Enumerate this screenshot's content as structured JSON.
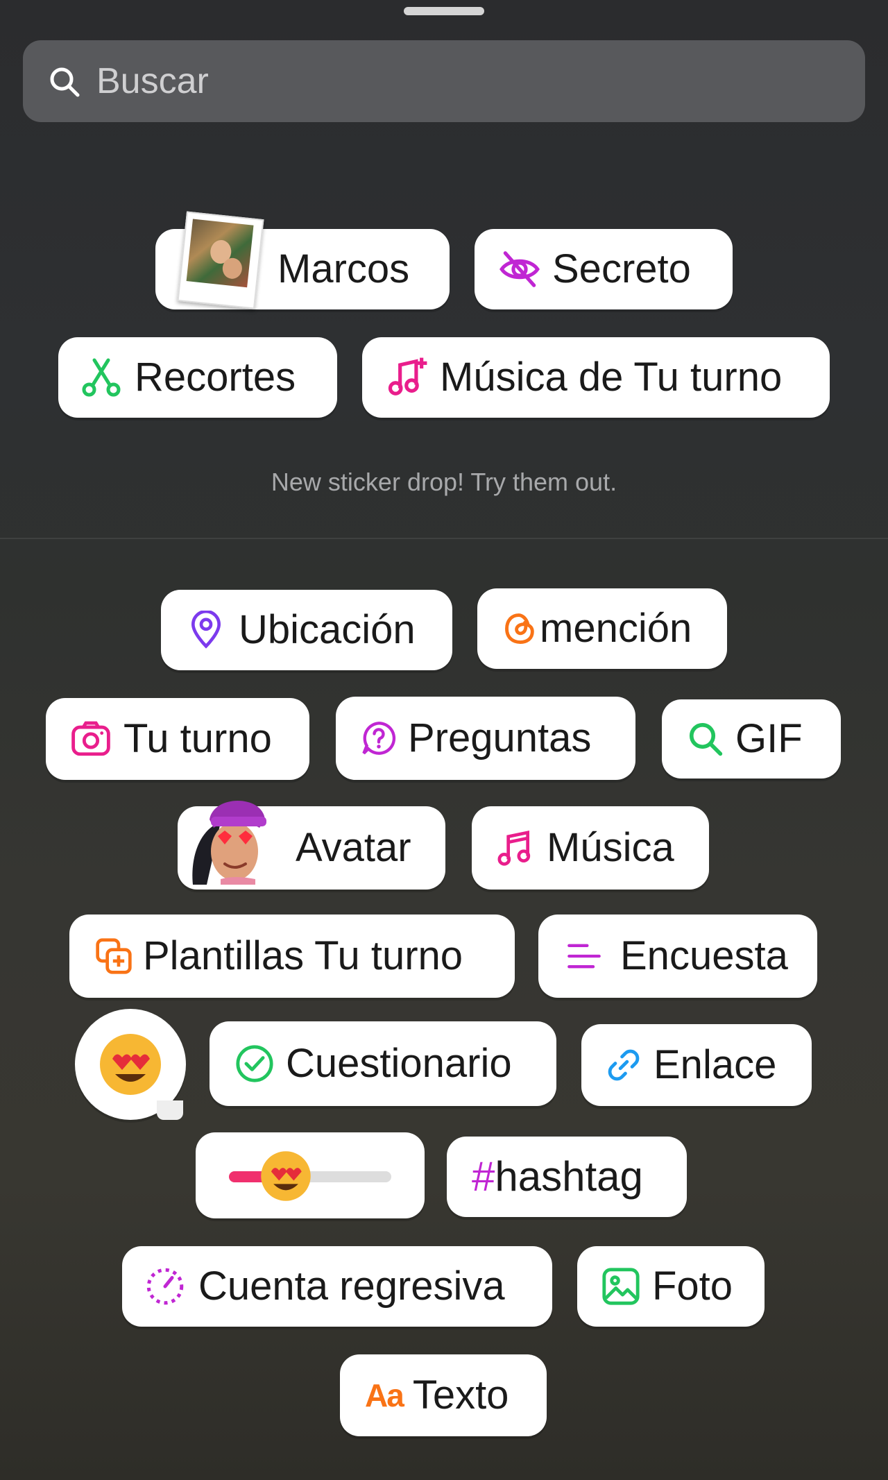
{
  "search": {
    "placeholder": "Buscar"
  },
  "featured": {
    "marcos": "Marcos",
    "secreto": "Secreto",
    "recortes": "Recortes",
    "musica_tu_turno": "Música de Tu turno"
  },
  "note": "New sticker drop! Try them out.",
  "stickers": {
    "ubicacion": "Ubicación",
    "mencion": "mención",
    "tu_turno": "Tu turno",
    "preguntas": "Preguntas",
    "gif": "GIF",
    "avatar": "Avatar",
    "musica": "Música",
    "plantillas": "Plantillas Tu turno",
    "encuesta": "Encuesta",
    "cuestionario": "Cuestionario",
    "enlace": "Enlace",
    "hashtag": "#hashtag",
    "cuenta_regresiva": "Cuenta regresiva",
    "foto": "Foto",
    "texto": "Texto"
  },
  "icons": {
    "search": "search-icon",
    "eye_off": "eye-off-icon",
    "scissors": "scissors-icon",
    "music_plus": "music-add-icon",
    "location": "location-pin-icon",
    "threads": "threads-icon",
    "camera": "camera-icon",
    "question": "question-bubble-icon",
    "gif_search": "search-icon",
    "music": "music-note-icon",
    "templates": "templates-icon",
    "poll": "poll-icon",
    "check": "check-circle-icon",
    "link": "link-icon",
    "countdown": "countdown-icon",
    "photo": "image-icon",
    "text": "text-aa-icon"
  },
  "colors": {
    "green": "#22c55e",
    "pink": "#e91e8c",
    "magenta": "#c026d3",
    "purple": "#7c3aed",
    "orange": "#f97316",
    "blue": "#1d9bf0"
  },
  "slider": {
    "value_fraction": 0.35
  }
}
